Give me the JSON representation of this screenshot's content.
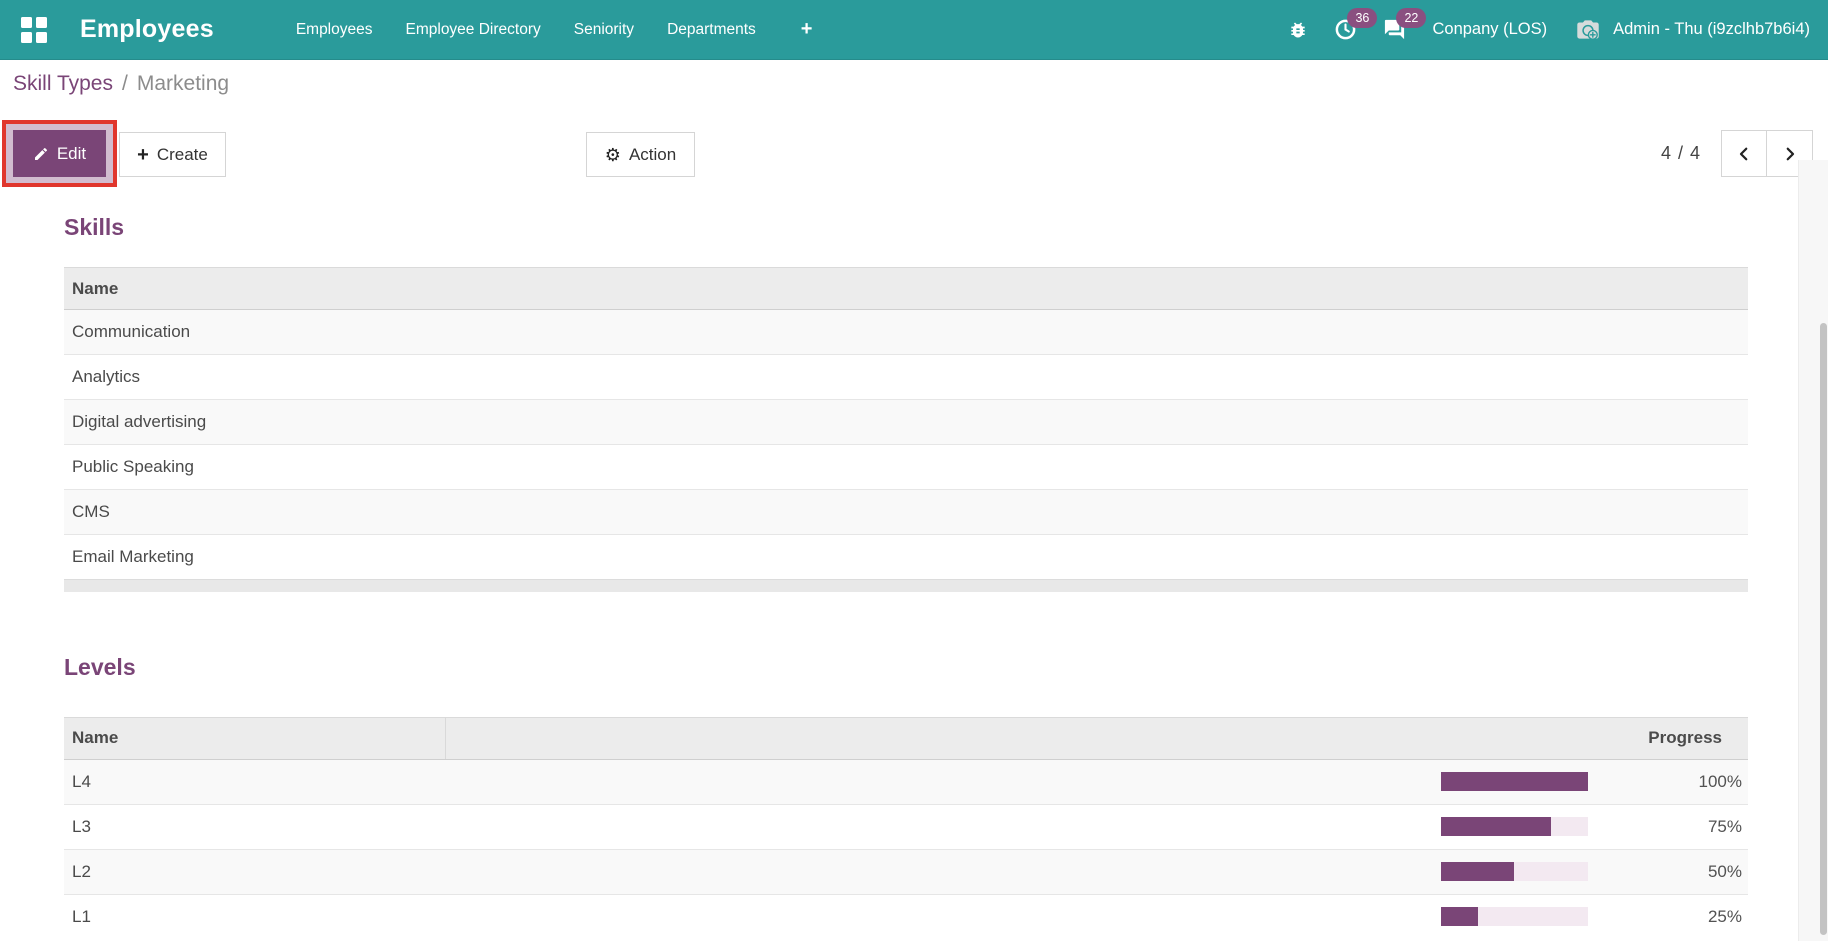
{
  "nav": {
    "brand": "Employees",
    "menus": [
      "Employees",
      "Employee Directory",
      "Seniority",
      "Departments"
    ],
    "add_label": "+",
    "activities_badge": "36",
    "messages_badge": "22",
    "company": "Conpany (LOS)",
    "user": "Admin - Thu (i9zclhb7b6i4)"
  },
  "breadcrumb": {
    "parent": "Skill Types",
    "separator": "/",
    "current": "Marketing"
  },
  "toolbar": {
    "edit_label": "Edit",
    "create_label": "Create",
    "action_label": "Action",
    "pager_value": "4 / 4"
  },
  "skills": {
    "title": "Skills",
    "column_name": "Name",
    "rows": [
      "Communication",
      "Analytics",
      "Digital advertising",
      "Public Speaking",
      "CMS",
      "Email Marketing"
    ]
  },
  "levels": {
    "title": "Levels",
    "columns": {
      "name": "Name",
      "progress": "Progress"
    },
    "rows": [
      {
        "name": "L4",
        "progress": 100,
        "percent_label": "100%"
      },
      {
        "name": "L3",
        "progress": 75,
        "percent_label": "75%"
      },
      {
        "name": "L2",
        "progress": 50,
        "percent_label": "50%"
      },
      {
        "name": "L1",
        "progress": 25,
        "percent_label": "25%"
      }
    ]
  },
  "icons": {
    "apps": "apps-grid",
    "debug": "bug",
    "activities": "clock",
    "messages": "chat-bubbles",
    "avatar": "camera-plus",
    "edit": "pencil",
    "create": "plus",
    "action": "gear",
    "pager_prev": "chevron-left",
    "pager_next": "chevron-right"
  },
  "colors": {
    "navbar_bg": "#2a9b9b",
    "badge_bg": "#8a4f80",
    "primary": "#7a4577",
    "heading": "#7a4577",
    "annotation_red": "#e0362d",
    "bar_track": "#f3e9f1",
    "bar_fill": "#7a4577",
    "table_header_bg": "#ececec",
    "row_alt": "#f9f9f9",
    "text_dark": "#4a4a4a"
  }
}
